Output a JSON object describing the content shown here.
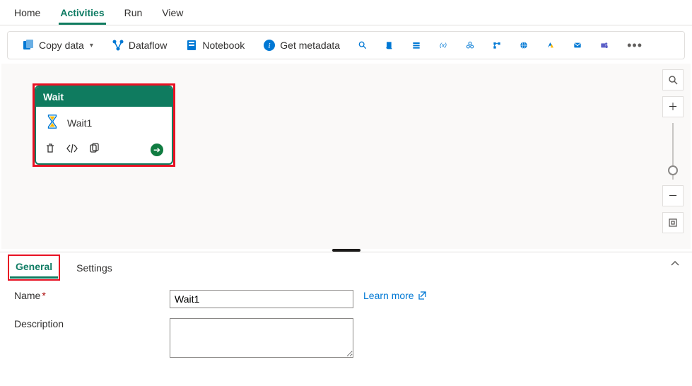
{
  "top_menu": {
    "home": "Home",
    "activities": "Activities",
    "run": "Run",
    "view": "View"
  },
  "toolbar": {
    "copy_data": "Copy data",
    "dataflow": "Dataflow",
    "notebook": "Notebook",
    "get_metadata": "Get metadata"
  },
  "activity": {
    "type": "Wait",
    "name": "Wait1"
  },
  "panel_tabs": {
    "general": "General",
    "settings": "Settings"
  },
  "form": {
    "name_label": "Name",
    "name_value": "Wait1",
    "description_label": "Description",
    "description_value": "",
    "learn_more": "Learn more"
  }
}
